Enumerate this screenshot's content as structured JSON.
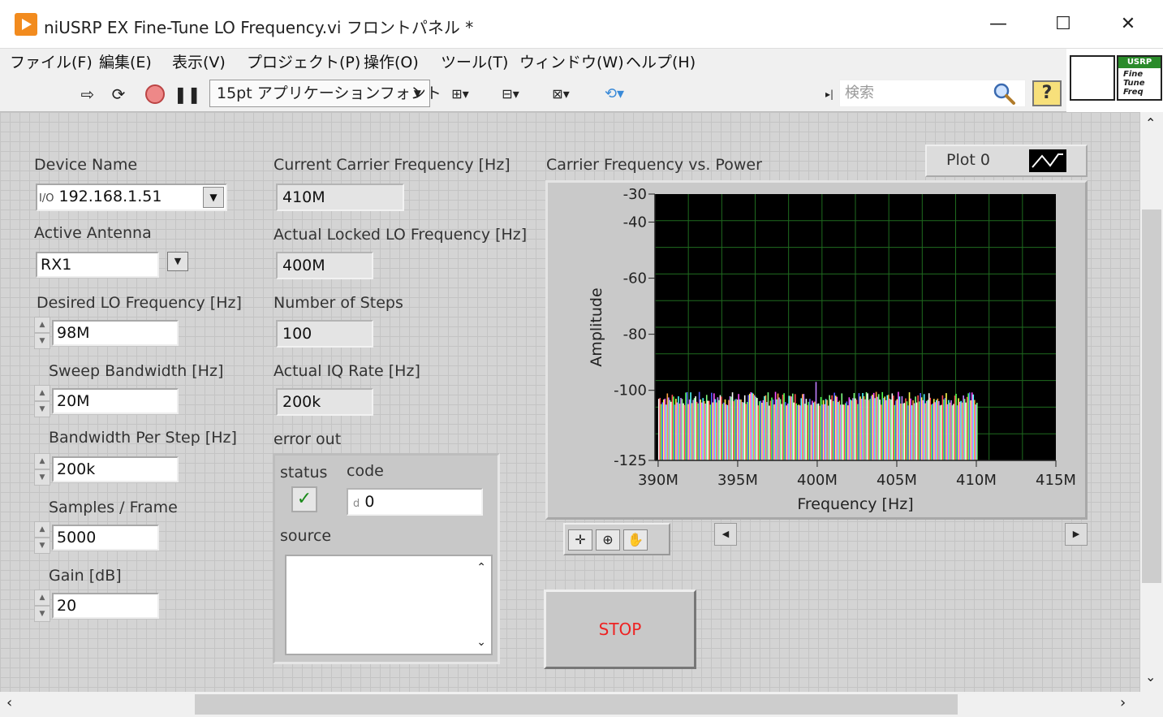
{
  "window": {
    "title": "niUSRP EX Fine-Tune LO Frequency.vi フロントパネル *",
    "minimize": "—",
    "maximize": "☐",
    "close": "✕"
  },
  "menu": [
    "ファイル(F)",
    "編集(E)",
    "表示(V)",
    "プロジェクト(P)",
    "操作(O)",
    "ツール(T)",
    "ウィンドウ(W)",
    "ヘルプ(H)"
  ],
  "toolbar": {
    "font_select": "15pt アプリケーションフォント",
    "search_placeholder": "検索",
    "help": "?"
  },
  "vi_icon": {
    "header": "USRP",
    "lines": [
      "Fine",
      "Tune",
      "Freq"
    ]
  },
  "controls": {
    "device_name": {
      "label": "Device Name",
      "value": "192.168.1.51",
      "prefix": "I/O"
    },
    "active_antenna": {
      "label": "Active Antenna",
      "value": "RX1"
    },
    "desired_lo": {
      "label": "Desired LO Frequency [Hz]",
      "value": "98M"
    },
    "sweep_bw": {
      "label": "Sweep Bandwidth [Hz]",
      "value": "20M"
    },
    "bw_per_step": {
      "label": "Bandwidth Per Step [Hz]",
      "value": "200k"
    },
    "samples_frame": {
      "label": "Samples / Frame",
      "value": "5000"
    },
    "gain": {
      "label": "Gain [dB]",
      "value": "20"
    }
  },
  "indicators": {
    "current_carrier": {
      "label": "Current Carrier Frequency [Hz]",
      "value": "410M"
    },
    "actual_lo": {
      "label": "Actual Locked LO Frequency [Hz]",
      "value": "400M"
    },
    "num_steps": {
      "label": "Number of Steps",
      "value": "100"
    },
    "actual_iq": {
      "label": "Actual IQ Rate [Hz]",
      "value": "200k"
    }
  },
  "error_out": {
    "label": "error out",
    "status_label": "status",
    "code_label": "code",
    "code_value": "0",
    "code_prefix": "d",
    "source_label": "source"
  },
  "graph": {
    "plot_legend": "Plot 0",
    "stop_label": "STOP"
  },
  "chart_data": {
    "type": "bar",
    "title": "Carrier Frequency vs. Power",
    "xlabel": "Frequency [Hz]",
    "ylabel": "Amplitude",
    "xlim": [
      389.8,
      415
    ],
    "ylim": [
      -125,
      -30
    ],
    "x_ticks": [
      "390M",
      "395M",
      "400M",
      "405M",
      "410M",
      "415M"
    ],
    "x_tick_values": [
      390,
      395,
      400,
      405,
      410,
      415
    ],
    "y_ticks": [
      "-30",
      "-40",
      "-60",
      "-80",
      "-100",
      "-125"
    ],
    "y_tick_values": [
      -30,
      -40,
      -60,
      -80,
      -100,
      -125
    ],
    "band": {
      "x_start": 390,
      "x_end": 410,
      "floor_db": -103,
      "jitter_db": 2.5,
      "peak_x": 399.9,
      "peak_db": -97
    },
    "grid": true,
    "background": "#000000",
    "grid_color": "#1f6b1f",
    "series_colors": [
      "#ffffff",
      "#ff5050",
      "#50ff50",
      "#5a5aff",
      "#ffff50",
      "#ff50ff",
      "#50ffff",
      "#ffa040",
      "#c080ff",
      "#80ff80"
    ]
  }
}
